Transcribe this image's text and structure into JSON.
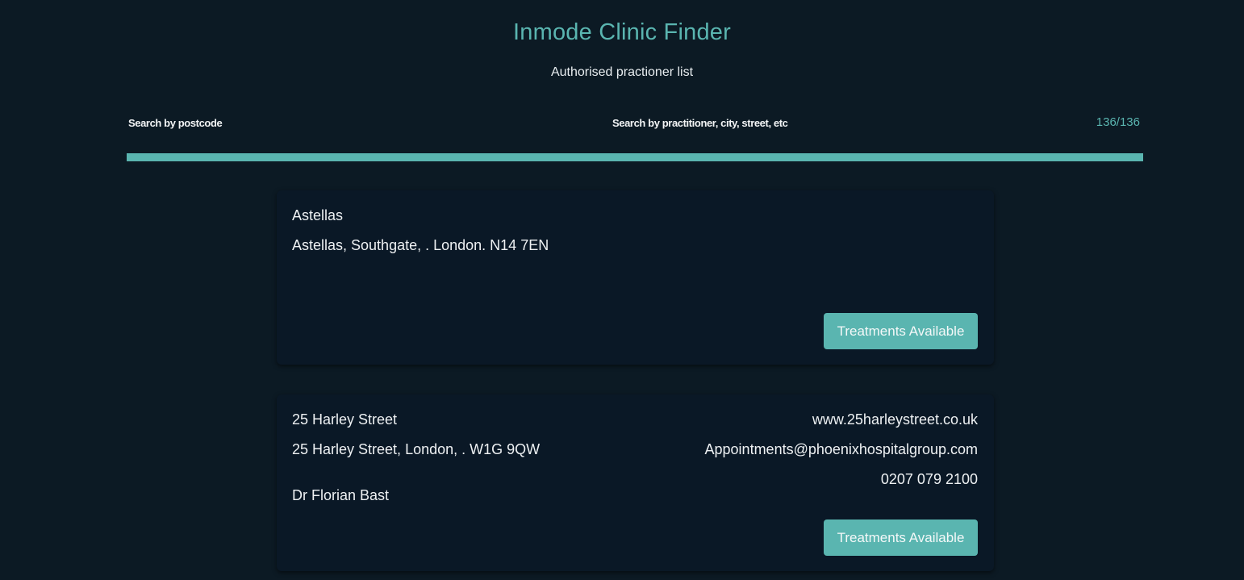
{
  "header": {
    "title": "Inmode Clinic Finder",
    "subtitle": "Authorised practioner list"
  },
  "search": {
    "postcode_placeholder": "Search by postcode",
    "postcode_value": "",
    "text_placeholder": "Search by practitioner, city, street, etc",
    "text_value": "",
    "count": "136/136"
  },
  "colors": {
    "accent": "#5ab5b0",
    "background": "#0c1a24",
    "card": "#0a1826"
  },
  "clinics": [
    {
      "name": "Astellas",
      "address": "Astellas, Southgate, . London. N14 7EN",
      "practitioner": "",
      "website": "",
      "email": "",
      "phone": "",
      "button_label": "Treatments Available"
    },
    {
      "name": "25 Harley Street",
      "address": "25 Harley Street, London, . W1G 9QW",
      "practitioner": "Dr Florian Bast",
      "website": "www.25harleystreet.co.uk",
      "email": "Appointments@phoenixhospitalgroup.com",
      "phone": "0207 079 2100",
      "button_label": "Treatments Available"
    }
  ]
}
